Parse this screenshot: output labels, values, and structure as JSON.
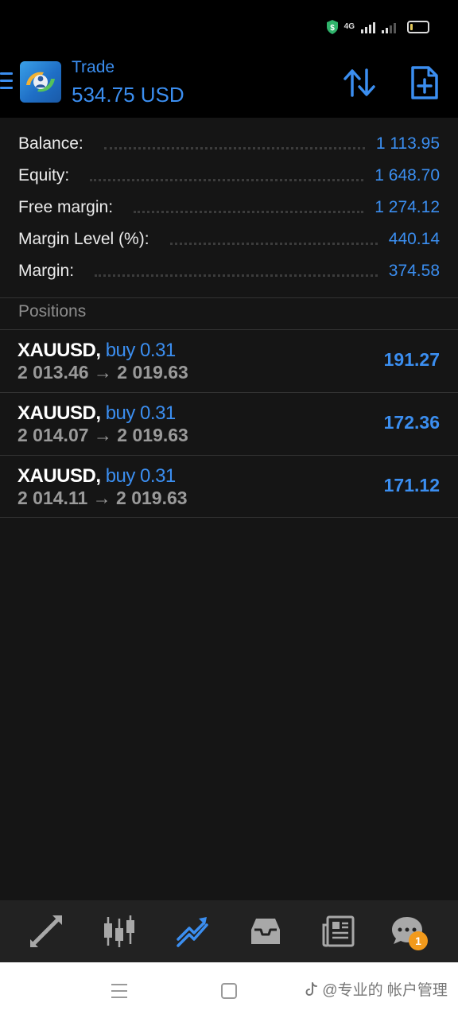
{
  "status_bar": {
    "network_label": "4G",
    "battery_color": "#e3c85b"
  },
  "header": {
    "title": "Trade",
    "value": "534.75 USD",
    "accent_color": "#3b8ef0",
    "icons": [
      "menu-icon",
      "metatrader-logo",
      "sort-arrows-icon",
      "new-order-icon"
    ]
  },
  "summary": [
    {
      "label": "Balance:",
      "value": "1 113.95"
    },
    {
      "label": "Equity:",
      "value": "1 648.70"
    },
    {
      "label": "Free margin:",
      "value": "1 274.12"
    },
    {
      "label": "Margin Level (%):",
      "value": "440.14"
    },
    {
      "label": "Margin:",
      "value": "374.58"
    }
  ],
  "positions_title": "Positions",
  "positions": [
    {
      "symbol": "XAUUSD,",
      "side": "buy 0.31",
      "prices": "2 013.46 → 2 019.63",
      "profit": "191.27"
    },
    {
      "symbol": "XAUUSD,",
      "side": "buy 0.31",
      "prices": "2 014.07 → 2 019.63",
      "profit": "172.36"
    },
    {
      "symbol": "XAUUSD,",
      "side": "buy 0.31",
      "prices": "2 014.11 → 2 019.63",
      "profit": "171.12"
    }
  ],
  "bottom_nav": {
    "items": [
      "quotes-icon",
      "chart-icon",
      "trade-icon",
      "history-icon",
      "news-icon",
      "messages-icon"
    ],
    "active": "trade-icon",
    "badge": "1"
  },
  "system_nav": {
    "watermark": "@专业的 帐户管理"
  }
}
